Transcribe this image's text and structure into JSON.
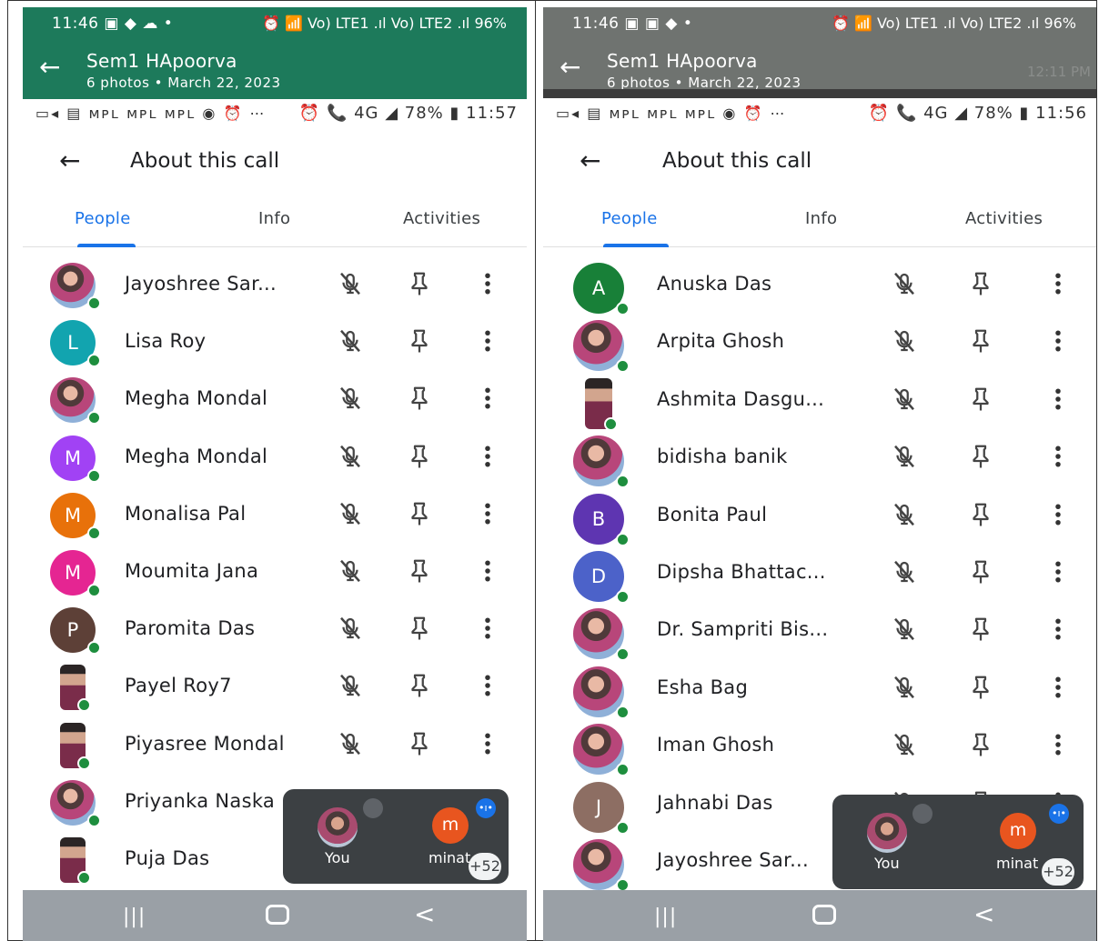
{
  "left": {
    "whatsapp": {
      "status_time": "11:46",
      "status_icons": "▣ ◆ ☁ •",
      "status_right": "⏰ 📶 Vo) LTE1 .ıl Vo) LTE2 .ıl 96%",
      "title": "Sem1 HApoorva",
      "subtitle": "6 photos  •  March 22, 2023",
      "faded_time": ""
    },
    "meet_status": {
      "left_icons": "▭◂ ▤ ᴍᴘʟ ᴍᴘʟ ᴍᴘʟ ◉ ⏰  ⋯",
      "right": "⏰ 📞 4G ◢ 78% ▮ 11:57"
    },
    "about": {
      "title": "About this call"
    },
    "tabs": [
      "People",
      "Info",
      "Activities"
    ],
    "people": [
      {
        "name": "Jayoshree Sar...",
        "initial": "",
        "color": "",
        "photo": "photo"
      },
      {
        "name": "Lisa Roy",
        "initial": "L",
        "color": "#12a4af",
        "photo": ""
      },
      {
        "name": "Megha Mondal",
        "initial": "",
        "color": "",
        "photo": "photo"
      },
      {
        "name": "Megha Mondal",
        "initial": "M",
        "color": "#a142f4",
        "photo": ""
      },
      {
        "name": "Monalisa Pal",
        "initial": "M",
        "color": "#e8710a",
        "photo": ""
      },
      {
        "name": "Moumita Jana",
        "initial": "M",
        "color": "#e52592",
        "photo": ""
      },
      {
        "name": "Paromita Das",
        "initial": "P",
        "color": "#5d4037",
        "photo": ""
      },
      {
        "name": "Payel Roy7",
        "initial": "",
        "color": "",
        "photo": "narrow"
      },
      {
        "name": "Piyasree Mondal",
        "initial": "",
        "color": "",
        "photo": "narrow"
      },
      {
        "name": "Priyanka Naska",
        "initial": "",
        "color": "",
        "photo": "photo"
      },
      {
        "name": "Puja Das",
        "initial": "",
        "color": "",
        "photo": "narrow"
      }
    ],
    "tile": {
      "you": "You",
      "minat": "minat",
      "m": "m",
      "count": "+52"
    },
    "nav": {
      "recents": "|||",
      "back": "<"
    }
  },
  "right": {
    "whatsapp": {
      "status_time": "11:46",
      "status_icons": "▣ ▣ ◆ •",
      "status_right": "⏰ 📶 Vo) LTE1 .ıl Vo) LTE2 .ıl 96%",
      "title": "Sem1 HApoorva",
      "subtitle": "6 photos  •  March 22, 2023",
      "faded_time": "12:11 PM"
    },
    "meet_status": {
      "left_icons": "▭◂ ▤ ᴍᴘʟ ᴍᴘʟ ᴍᴘʟ ◉ ⏰  ⋯",
      "right": "⏰ 📞 4G ◢ 78% ▮ 11:56"
    },
    "about": {
      "title": "About this call"
    },
    "tabs": [
      "People",
      "Info",
      "Activities"
    ],
    "people": [
      {
        "name": "Anuska Das",
        "initial": "A",
        "color": "#188038",
        "photo": ""
      },
      {
        "name": "Arpita Ghosh",
        "initial": "",
        "color": "",
        "photo": "photo"
      },
      {
        "name": "Ashmita Dasgu...",
        "initial": "",
        "color": "",
        "photo": "narrow"
      },
      {
        "name": "bidisha banik",
        "initial": "",
        "color": "",
        "photo": "photo"
      },
      {
        "name": "Bonita Paul",
        "initial": "B",
        "color": "#5e35b1",
        "photo": ""
      },
      {
        "name": "Dipsha Bhattac...",
        "initial": "D",
        "color": "#4c62c9",
        "photo": ""
      },
      {
        "name": "Dr. Sampriti Bis...",
        "initial": "",
        "color": "",
        "photo": "photo"
      },
      {
        "name": "Esha Bag",
        "initial": "",
        "color": "",
        "photo": "photo"
      },
      {
        "name": "Iman Ghosh",
        "initial": "",
        "color": "",
        "photo": "photo"
      },
      {
        "name": "Jahnabi Das",
        "initial": "J",
        "color": "#8d6e63",
        "photo": ""
      },
      {
        "name": "Jayoshree Sar...",
        "initial": "",
        "color": "",
        "photo": "photo"
      }
    ],
    "tile": {
      "you": "You",
      "minat": "minat",
      "m": "m",
      "count": "+52"
    },
    "nav": {
      "recents": "|||",
      "back": "<"
    }
  },
  "colors": {
    "whatsapp_green": "#1d7a5b",
    "accent_blue": "#1a73e8",
    "online_green": "#1e8e3e"
  }
}
